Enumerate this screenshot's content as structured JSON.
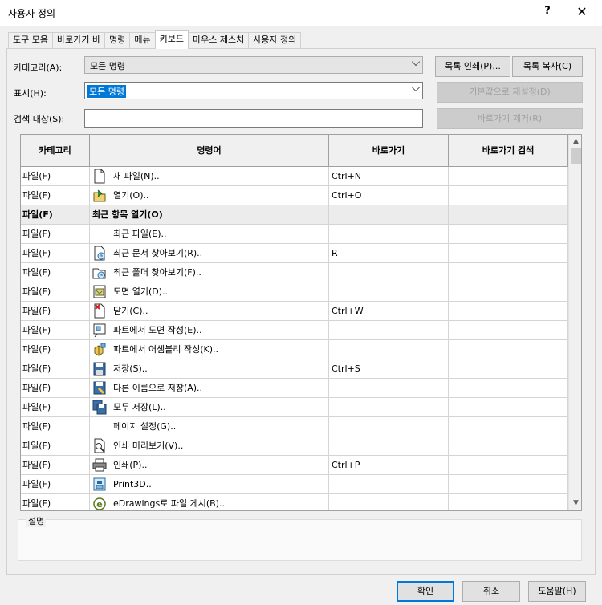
{
  "window": {
    "title": "사용자 정의",
    "help_glyph": "?",
    "close_glyph": "✕"
  },
  "tabs": [
    {
      "label": "도구 모음",
      "active": false
    },
    {
      "label": "바로가기 바",
      "active": false
    },
    {
      "label": "명령",
      "active": false
    },
    {
      "label": "메뉴",
      "active": false
    },
    {
      "label": "키보드",
      "active": true
    },
    {
      "label": "마우스 제스처",
      "active": false
    },
    {
      "label": "사용자 정의",
      "active": false
    }
  ],
  "form": {
    "category_label": "카테고리(A):",
    "category_value": "모든 명령",
    "show_label": "표시(H):",
    "show_value": "모든 명령",
    "search_label": "검색 대상(S):",
    "search_value": ""
  },
  "buttons": {
    "print_list": "목록 인쇄(P)...",
    "copy_list": "목록 복사(C)",
    "reset_defaults": "기본값으로 재설정(D)",
    "remove_shortcut": "바로가기 제거(R)",
    "ok": "확인",
    "cancel": "취소",
    "help": "도움말(H)"
  },
  "grid": {
    "headers": {
      "category": "카테고리",
      "command": "명령어",
      "shortcut": "바로가기",
      "shortcut_search": "바로가기 검색"
    },
    "rows": [
      {
        "category": "파일(F)",
        "command": "새 파일(N)..",
        "shortcut": "Ctrl+N",
        "icon": "new-file-icon",
        "group": false
      },
      {
        "category": "파일(F)",
        "command": "열기(O)..",
        "shortcut": "Ctrl+O",
        "icon": "open-file-icon",
        "group": false
      },
      {
        "category": "파일(F)",
        "command": "최근 항목 열기(O)",
        "shortcut": "",
        "icon": "",
        "group": true
      },
      {
        "category": "파일(F)",
        "command": "최근 파일(E)..",
        "shortcut": "",
        "icon": "",
        "group": false
      },
      {
        "category": "파일(F)",
        "command": "최근 문서 찾아보기(R)..",
        "shortcut": "R",
        "icon": "browse-recent-documents-icon",
        "group": false
      },
      {
        "category": "파일(F)",
        "command": "최근 폴더 찾아보기(F)..",
        "shortcut": "",
        "icon": "browse-recent-folders-icon",
        "group": false
      },
      {
        "category": "파일(F)",
        "command": "도면 열기(D)..",
        "shortcut": "",
        "icon": "open-drawing-icon",
        "group": false
      },
      {
        "category": "파일(F)",
        "command": "닫기(C)..",
        "shortcut": "Ctrl+W",
        "icon": "close-file-icon",
        "group": false
      },
      {
        "category": "파일(F)",
        "command": "파트에서 도면 작성(E)..",
        "shortcut": "",
        "icon": "make-drawing-from-part-icon",
        "group": false
      },
      {
        "category": "파일(F)",
        "command": "파트에서 어셈블리 작성(K)..",
        "shortcut": "",
        "icon": "make-assembly-from-part-icon",
        "group": false
      },
      {
        "category": "파일(F)",
        "command": "저장(S)..",
        "shortcut": "Ctrl+S",
        "icon": "save-icon",
        "group": false
      },
      {
        "category": "파일(F)",
        "command": "다른 이름으로 저장(A)..",
        "shortcut": "",
        "icon": "save-as-icon",
        "group": false
      },
      {
        "category": "파일(F)",
        "command": "모두 저장(L)..",
        "shortcut": "",
        "icon": "save-all-icon",
        "group": false
      },
      {
        "category": "파일(F)",
        "command": "페이지 설정(G)..",
        "shortcut": "",
        "icon": "",
        "group": false
      },
      {
        "category": "파일(F)",
        "command": "인쇄 미리보기(V)..",
        "shortcut": "",
        "icon": "print-preview-icon",
        "group": false
      },
      {
        "category": "파일(F)",
        "command": "인쇄(P)..",
        "shortcut": "Ctrl+P",
        "icon": "print-icon",
        "group": false
      },
      {
        "category": "파일(F)",
        "command": "Print3D..",
        "shortcut": "",
        "icon": "print3d-icon",
        "group": false
      },
      {
        "category": "파일(F)",
        "command": "eDrawings로 파일 게시(B)..",
        "shortcut": "",
        "icon": "edrawings-icon",
        "group": false
      }
    ]
  },
  "description": {
    "label": "설명",
    "text": ""
  },
  "colors": {
    "selection": "#0078d7",
    "primary_border": "#0078d7",
    "dialog_bg": "#f0f0f0"
  }
}
